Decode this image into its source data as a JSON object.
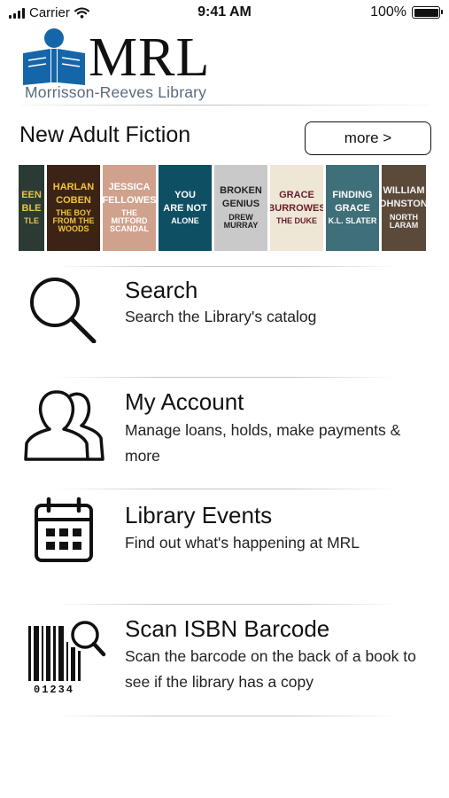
{
  "status_bar": {
    "carrier": "Carrier",
    "time": "9:41 AM",
    "battery": "100%",
    "icons": [
      "signal-icon",
      "wifi-icon",
      "battery-icon"
    ]
  },
  "logo": {
    "letters": "MRL",
    "subtitle": "Morrisson-Reeves Library",
    "colors": {
      "mark": "#1566a8",
      "subtitle": "#5a6b7c"
    }
  },
  "new_fiction": {
    "title": "New Adult Fiction",
    "more_label": "more >",
    "covers": [
      {
        "line1": "EEN",
        "line2": "BLE",
        "line3": "TLE",
        "bg": "#2b3a33",
        "fg": "#e7c34b"
      },
      {
        "line1": "HARLAN",
        "line2": "COBEN",
        "line3": "THE BOY FROM THE WOODS",
        "bg": "#3b2416",
        "fg": "#f2c23d"
      },
      {
        "line1": "JESSICA",
        "line2": "FELLOWES",
        "line3": "THE MITFORD SCANDAL",
        "bg": "#d0a18c",
        "fg": "#ffffff"
      },
      {
        "line1": "YOU",
        "line2": "ARE NOT",
        "line3": "ALONE",
        "bg": "#0f4f63",
        "fg": "#ffffff"
      },
      {
        "line1": "BROKEN",
        "line2": "GENIUS",
        "line3": "DREW MURRAY",
        "bg": "#c9c9c9",
        "fg": "#222222"
      },
      {
        "line1": "GRACE",
        "line2": "BURROWES",
        "line3": "THE DUKE",
        "bg": "#efe7d6",
        "fg": "#6a1c2c"
      },
      {
        "line1": "FINDING",
        "line2": "GRACE",
        "line3": "K.L. SLATER",
        "bg": "#3f6f78",
        "fg": "#ffffff"
      },
      {
        "line1": "WILLIAM",
        "line2": "JOHNSTONE",
        "line3": "NORTH LARAM",
        "bg": "#5b4a3a",
        "fg": "#f1f1f1"
      }
    ]
  },
  "menu": [
    {
      "title": "Search",
      "description": "Search the Library's catalog",
      "icon": "search-icon"
    },
    {
      "title": "My Account",
      "description": "Manage loans, holds, make payments & more",
      "icon": "users-icon"
    },
    {
      "title": "Library Events",
      "description": "Find out what's happening at MRL",
      "icon": "calendar-icon"
    },
    {
      "title": "Scan ISBN Barcode",
      "description": "Scan the barcode on the back of a book to see if the library has a copy",
      "icon": "barcode-scan-icon",
      "barcode_digits": "01234"
    }
  ]
}
